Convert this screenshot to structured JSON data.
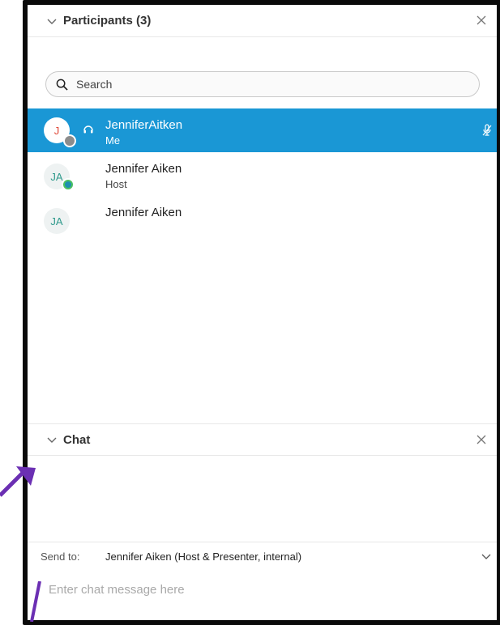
{
  "participants_panel": {
    "title": "Participants (3)",
    "search_placeholder": "Search",
    "items": [
      {
        "initials": "J",
        "name": "JenniferAitken",
        "role": "Me"
      },
      {
        "initials": "JA",
        "name": "Jennifer Aiken",
        "role": "Host"
      },
      {
        "initials": "JA",
        "name": "Jennifer Aiken",
        "role": ""
      }
    ]
  },
  "chat_panel": {
    "title": "Chat",
    "send_to_label": "Send to:",
    "send_to_value": "Jennifer Aiken (Host & Presenter, internal)",
    "input_placeholder": "Enter chat message here"
  },
  "colors": {
    "selected_row": "#1a97d5",
    "annotation_arrow": "#6b2fb3",
    "frame_border": "#0a0a0a"
  }
}
